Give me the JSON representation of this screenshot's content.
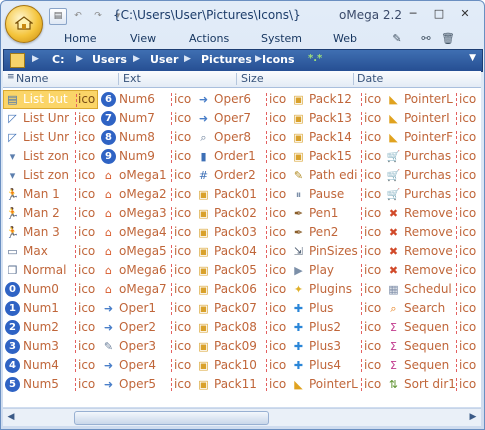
{
  "title_path": "{C:\\Users\\User\\Pictures\\Icons\\}",
  "app_name": "oMega 2.2",
  "qat": {
    "btn1": "▤",
    "undo": "↶",
    "redo": "↷",
    "more": "▾"
  },
  "window_buttons": {
    "minimize": "─",
    "maximize": "□",
    "close": "✕"
  },
  "menu": [
    "Home",
    "View",
    "Actions",
    "System",
    "Web"
  ],
  "address": {
    "crumbs": [
      "C:",
      "Users",
      "User",
      "Pictures",
      "Icons"
    ],
    "extra": "*.*"
  },
  "columns": [
    "Name",
    "Ext",
    "Size",
    "Date"
  ],
  "colors": {
    "accent": "#264f93",
    "file_text": "#c0663a",
    "selection": "#fbd568"
  },
  "files": [
    [
      {
        "name": "List but",
        "ext": "ico",
        "icon": "list-button-icon",
        "sel": true
      },
      {
        "name": "List Unr",
        "ext": "ico",
        "icon": "list-unresize-icon"
      },
      {
        "name": "List Unr",
        "ext": "ico",
        "icon": "list-unresize-icon"
      },
      {
        "name": "List zon",
        "ext": "ico",
        "icon": "list-zone-icon"
      },
      {
        "name": "List zon",
        "ext": "ico",
        "icon": "list-zone-icon"
      },
      {
        "name": "Man 1",
        "ext": "ico",
        "icon": "man-running-icon"
      },
      {
        "name": "Man 2",
        "ext": "ico",
        "icon": "man-running-icon"
      },
      {
        "name": "Man 3",
        "ext": "ico",
        "icon": "man-running-icon"
      },
      {
        "name": "Max",
        "ext": "ico",
        "icon": "window-max-icon"
      },
      {
        "name": "Normal",
        "ext": "ico",
        "icon": "window-normal-icon"
      },
      {
        "name": "Num0",
        "ext": "ico",
        "icon": "number-0-icon"
      },
      {
        "name": "Num1",
        "ext": "ico",
        "icon": "number-1-icon"
      },
      {
        "name": "Num2",
        "ext": "ico",
        "icon": "number-2-icon"
      },
      {
        "name": "Num3",
        "ext": "ico",
        "icon": "number-3-icon"
      },
      {
        "name": "Num4",
        "ext": "ico",
        "icon": "number-4-icon"
      },
      {
        "name": "Num5",
        "ext": "ico",
        "icon": "number-5-icon"
      }
    ],
    [
      {
        "name": "Num6",
        "ext": "ico",
        "icon": "number-6-icon"
      },
      {
        "name": "Num7",
        "ext": "ico",
        "icon": "number-7-icon"
      },
      {
        "name": "Num8",
        "ext": "ico",
        "icon": "number-8-icon"
      },
      {
        "name": "Num9",
        "ext": "ico",
        "icon": "number-9-icon"
      },
      {
        "name": "oMega1",
        "ext": "ico",
        "icon": "omega-house-icon"
      },
      {
        "name": "oMega2",
        "ext": "ico",
        "icon": "omega-house-icon"
      },
      {
        "name": "oMega3",
        "ext": "ico",
        "icon": "omega-house-icon"
      },
      {
        "name": "oMega4",
        "ext": "ico",
        "icon": "omega-house-icon"
      },
      {
        "name": "oMega5",
        "ext": "ico",
        "icon": "omega-house-icon"
      },
      {
        "name": "oMega6",
        "ext": "ico",
        "icon": "omega-house-icon"
      },
      {
        "name": "oMega7",
        "ext": "ico",
        "icon": "omega-house-icon"
      },
      {
        "name": "Oper1",
        "ext": "ico",
        "icon": "operation-icon"
      },
      {
        "name": "Oper2",
        "ext": "ico",
        "icon": "operation-icon"
      },
      {
        "name": "Oper3",
        "ext": "ico",
        "icon": "operation-edit-icon"
      },
      {
        "name": "Oper4",
        "ext": "ico",
        "icon": "operation-icon"
      },
      {
        "name": "Oper5",
        "ext": "ico",
        "icon": "operation-icon"
      }
    ],
    [
      {
        "name": "Oper6",
        "ext": "ico",
        "icon": "operation-icon"
      },
      {
        "name": "Oper7",
        "ext": "ico",
        "icon": "operation-icon"
      },
      {
        "name": "Oper8",
        "ext": "ico",
        "icon": "operation-search-icon"
      },
      {
        "name": "Order1",
        "ext": "ico",
        "icon": "order-bars-icon"
      },
      {
        "name": "Order2",
        "ext": "ico",
        "icon": "order-numbers-icon"
      },
      {
        "name": "Pack01",
        "ext": "ico",
        "icon": "pack-icon"
      },
      {
        "name": "Pack02",
        "ext": "ico",
        "icon": "pack-icon"
      },
      {
        "name": "Pack03",
        "ext": "ico",
        "icon": "pack-icon"
      },
      {
        "name": "Pack04",
        "ext": "ico",
        "icon": "pack-icon"
      },
      {
        "name": "Pack05",
        "ext": "ico",
        "icon": "pack-icon"
      },
      {
        "name": "Pack06",
        "ext": "ico",
        "icon": "pack-icon"
      },
      {
        "name": "Pack07",
        "ext": "ico",
        "icon": "pack-icon"
      },
      {
        "name": "Pack08",
        "ext": "ico",
        "icon": "pack-icon"
      },
      {
        "name": "Pack09",
        "ext": "ico",
        "icon": "pack-icon"
      },
      {
        "name": "Pack10",
        "ext": "ico",
        "icon": "pack-icon"
      },
      {
        "name": "Pack11",
        "ext": "ico",
        "icon": "pack-icon"
      }
    ],
    [
      {
        "name": "Pack12",
        "ext": "ico",
        "icon": "pack-icon"
      },
      {
        "name": "Pack13",
        "ext": "ico",
        "icon": "pack-icon"
      },
      {
        "name": "Pack14",
        "ext": "ico",
        "icon": "pack-icon"
      },
      {
        "name": "Pack15",
        "ext": "ico",
        "icon": "pack-icon"
      },
      {
        "name": "Path edi",
        "ext": "ico",
        "icon": "path-edit-icon"
      },
      {
        "name": "Pause",
        "ext": "ico",
        "icon": "pause-icon"
      },
      {
        "name": "Pen1",
        "ext": "ico",
        "icon": "pen-icon"
      },
      {
        "name": "Pen2",
        "ext": "ico",
        "icon": "pen-icon"
      },
      {
        "name": "PinSizes",
        "ext": "ico",
        "icon": "pin-sizes-icon"
      },
      {
        "name": "Play",
        "ext": "ico",
        "icon": "play-icon"
      },
      {
        "name": "Plugins",
        "ext": "ico",
        "icon": "plugins-icon"
      },
      {
        "name": "Plus",
        "ext": "ico",
        "icon": "plus-icon"
      },
      {
        "name": "Plus2",
        "ext": "ico",
        "icon": "plus-icon"
      },
      {
        "name": "Plus3",
        "ext": "ico",
        "icon": "plus-icon"
      },
      {
        "name": "Plus4",
        "ext": "ico",
        "icon": "plus-icon"
      },
      {
        "name": "PointerL",
        "ext": "ico",
        "icon": "pointer-icon"
      }
    ],
    [
      {
        "name": "PointerL",
        "ext": "ico",
        "icon": "pointer-icon"
      },
      {
        "name": "PointerI",
        "ext": "ico",
        "icon": "pointer-icon"
      },
      {
        "name": "PointerF",
        "ext": "ico",
        "icon": "pointer-icon"
      },
      {
        "name": "Purchas",
        "ext": "ico",
        "icon": "cart-icon"
      },
      {
        "name": "Purchas",
        "ext": "ico",
        "icon": "cart-icon"
      },
      {
        "name": "Purchas",
        "ext": "ico",
        "icon": "cart-icon"
      },
      {
        "name": "Remove",
        "ext": "ico",
        "icon": "remove-x-icon"
      },
      {
        "name": "Remove",
        "ext": "ico",
        "icon": "remove-x-icon"
      },
      {
        "name": "Remove",
        "ext": "ico",
        "icon": "remove-x-icon"
      },
      {
        "name": "Remove",
        "ext": "ico",
        "icon": "remove-x-icon"
      },
      {
        "name": "Schedul",
        "ext": "ico",
        "icon": "schedule-icon"
      },
      {
        "name": "Search",
        "ext": "ico",
        "icon": "search-icon"
      },
      {
        "name": "Sequen",
        "ext": "ico",
        "icon": "sequence-icon"
      },
      {
        "name": "Sequen",
        "ext": "ico",
        "icon": "sequence-icon"
      },
      {
        "name": "Sequen",
        "ext": "ico",
        "icon": "sequence-icon"
      },
      {
        "name": "Sort dir1",
        "ext": "ico",
        "icon": "sort-icon"
      }
    ]
  ]
}
